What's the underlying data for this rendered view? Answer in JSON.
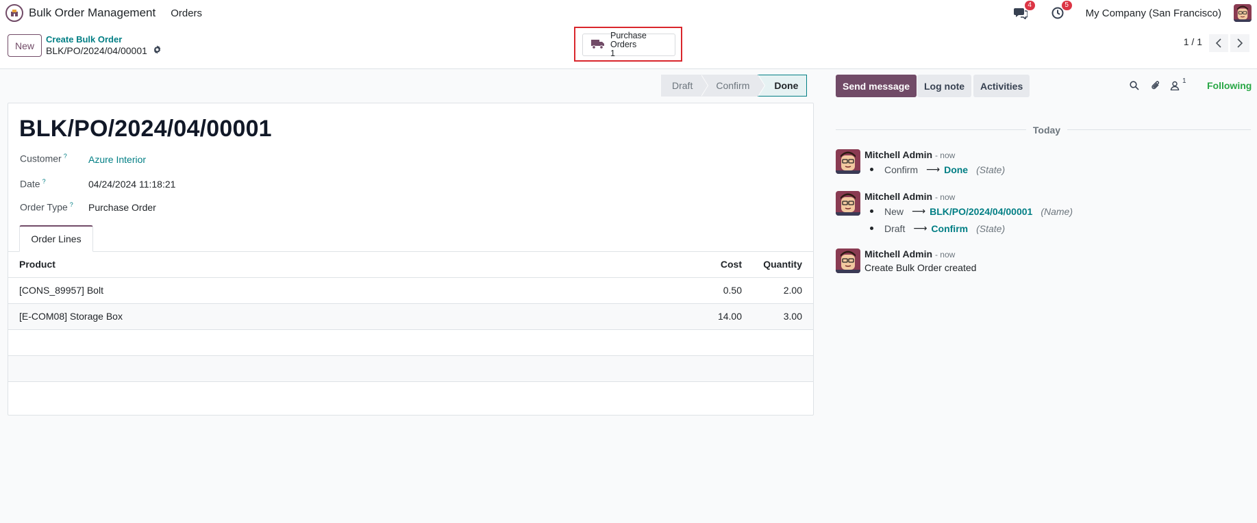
{
  "navbar": {
    "app_name": "Bulk Order Management",
    "menu_orders": "Orders",
    "messages_badge": "4",
    "activities_badge": "5",
    "company": "My Company (San Francisco)"
  },
  "control_panel": {
    "new_label": "New",
    "breadcrumb_parent": "Create Bulk Order",
    "breadcrumb_current": "BLK/PO/2024/04/00001",
    "smart_button_label": "Purchase Orders",
    "smart_button_count": "1",
    "pager": "1 / 1"
  },
  "statusbar": {
    "stages": [
      "Draft",
      "Confirm",
      "Done"
    ],
    "active": "Done"
  },
  "form": {
    "title": "BLK/PO/2024/04/00001",
    "customer_label": "Customer",
    "customer_value": "Azure Interior",
    "date_label": "Date",
    "date_value": "04/24/2024 11:18:21",
    "order_type_label": "Order Type",
    "order_type_value": "Purchase Order",
    "help_mark": "?",
    "tab_label": "Order Lines",
    "columns": {
      "product": "Product",
      "cost": "Cost",
      "quantity": "Quantity"
    },
    "lines": [
      {
        "product": "[CONS_89957] Bolt",
        "cost": "0.50",
        "quantity": "2.00"
      },
      {
        "product": "[E-COM08] Storage Box",
        "cost": "14.00",
        "quantity": "3.00"
      }
    ]
  },
  "chatter": {
    "send_message": "Send message",
    "log_note": "Log note",
    "activities": "Activities",
    "followers_count": "1",
    "following": "Following",
    "date_separator": "Today",
    "messages": [
      {
        "author": "Mitchell Admin",
        "date": "- now",
        "tracking": [
          {
            "old": "Confirm",
            "new": "Done",
            "field": "(State)"
          }
        ]
      },
      {
        "author": "Mitchell Admin",
        "date": "- now",
        "tracking": [
          {
            "old": "New",
            "new": "BLK/PO/2024/04/00001",
            "field": "(Name)"
          },
          {
            "old": "Draft",
            "new": "Confirm",
            "field": "(State)"
          }
        ]
      },
      {
        "author": "Mitchell Admin",
        "date": "- now",
        "body": "Create Bulk Order created"
      }
    ],
    "arrow": "⟶"
  },
  "colors": {
    "brand": "#714B67",
    "link": "#017e84",
    "badge": "#dc3545",
    "following": "#28a745",
    "highlight_box": "#d9262c"
  },
  "icons": [
    "app-icon",
    "chat-icon",
    "clock-icon",
    "gear-icon",
    "truck-icon",
    "chevron-left-icon",
    "chevron-right-icon",
    "search-icon",
    "paperclip-icon",
    "user-icon"
  ]
}
